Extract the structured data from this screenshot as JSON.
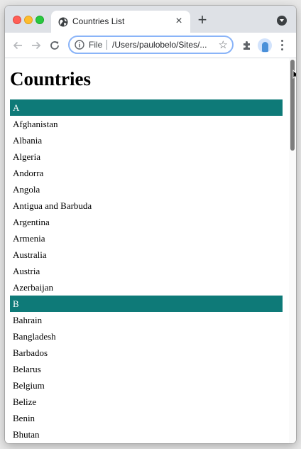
{
  "browser": {
    "tab_title": "Countries List",
    "tab_close": "×",
    "new_tab": "+",
    "address_scheme": "File",
    "address_url": "/Users/paulobelo/Sites/...",
    "star": "☆"
  },
  "page": {
    "heading": "Countries",
    "sections": [
      {
        "letter": "A",
        "countries": [
          "Afghanistan",
          "Albania",
          "Algeria",
          "Andorra",
          "Angola",
          "Antigua and Barbuda",
          "Argentina",
          "Armenia",
          "Australia",
          "Austria",
          "Azerbaijan"
        ]
      },
      {
        "letter": "B",
        "countries": [
          "Bahrain",
          "Bangladesh",
          "Barbados",
          "Belarus",
          "Belgium",
          "Belize",
          "Benin",
          "Bhutan"
        ]
      }
    ]
  },
  "colors": {
    "section_header": "#0e7a78",
    "tab_strip": "#dee1e6",
    "omnibox_focus": "#8ab4f8"
  },
  "icons": [
    "globe-icon",
    "back-arrow-icon",
    "forward-arrow-icon",
    "reload-icon",
    "info-icon",
    "star-icon",
    "puzzle-icon",
    "avatar",
    "more-vert-icon",
    "tab-search-icon"
  ]
}
